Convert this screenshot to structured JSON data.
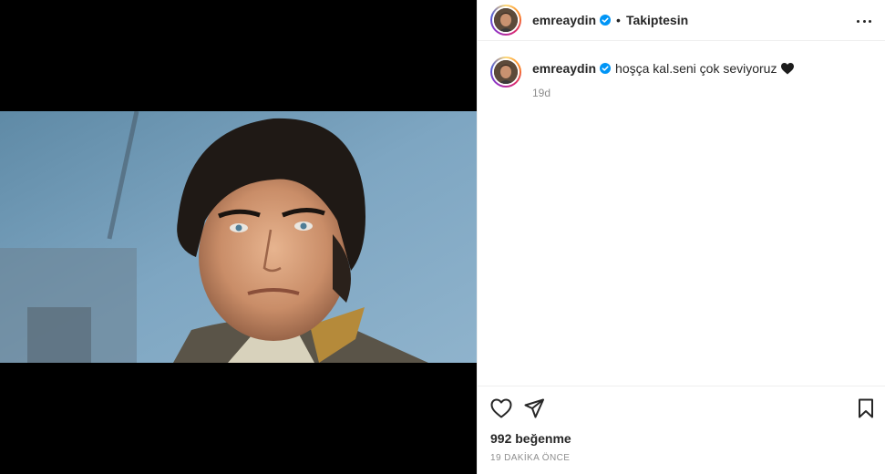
{
  "post": {
    "username": "emreaydin",
    "follow_status": "Takiptesin",
    "separator": "•",
    "caption_text": "hoşça kal.seni çok seviyoruz",
    "caption_emoji": "black-heart-icon",
    "caption_age": "19d",
    "likes": "992 beğenme",
    "posted_ago": "19 DAKİKA ÖNCE"
  },
  "colors": {
    "verified": "#0095f6",
    "text": "#262626",
    "muted": "#8e8e8e",
    "border": "#efefef",
    "media_bg": "#000000"
  },
  "icons": {
    "more": "more-options-icon",
    "like": "heart-outline-icon",
    "share": "paper-plane-icon",
    "save": "bookmark-icon",
    "verified": "verified-badge-icon"
  }
}
